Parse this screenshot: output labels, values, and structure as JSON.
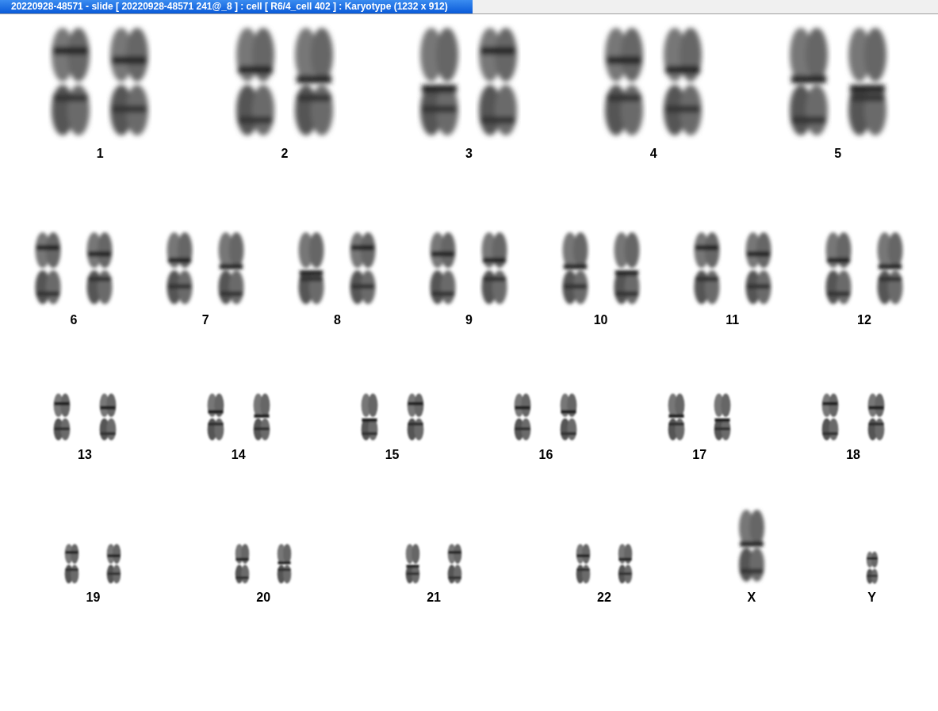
{
  "window": {
    "title": "20220928-48571 - slide [ 20220928-48571 241@_8 ] : cell [ R6/4_cell 402 ] : Karyotype  (1232 x 912)"
  },
  "rows": [
    [
      {
        "label": "1",
        "kind": "pair"
      },
      {
        "label": "2",
        "kind": "pair"
      },
      {
        "label": "3",
        "kind": "pair"
      },
      {
        "label": "4",
        "kind": "pair"
      },
      {
        "label": "5",
        "kind": "pair"
      }
    ],
    [
      {
        "label": "6",
        "kind": "pair"
      },
      {
        "label": "7",
        "kind": "pair"
      },
      {
        "label": "8",
        "kind": "pair"
      },
      {
        "label": "9",
        "kind": "pair"
      },
      {
        "label": "10",
        "kind": "pair"
      },
      {
        "label": "11",
        "kind": "pair"
      },
      {
        "label": "12",
        "kind": "pair"
      }
    ],
    [
      {
        "label": "13",
        "kind": "pair"
      },
      {
        "label": "14",
        "kind": "pair"
      },
      {
        "label": "15",
        "kind": "pair"
      },
      {
        "label": "16",
        "kind": "pair"
      },
      {
        "label": "17",
        "kind": "pair"
      },
      {
        "label": "18",
        "kind": "pair"
      }
    ],
    [
      {
        "label": "19",
        "kind": "pair"
      },
      {
        "label": "20",
        "kind": "pair"
      },
      {
        "label": "21",
        "kind": "pair"
      },
      {
        "label": "22",
        "kind": "pair"
      },
      {
        "label": "X",
        "kind": "single"
      },
      {
        "label": "Y",
        "kind": "single"
      }
    ]
  ]
}
